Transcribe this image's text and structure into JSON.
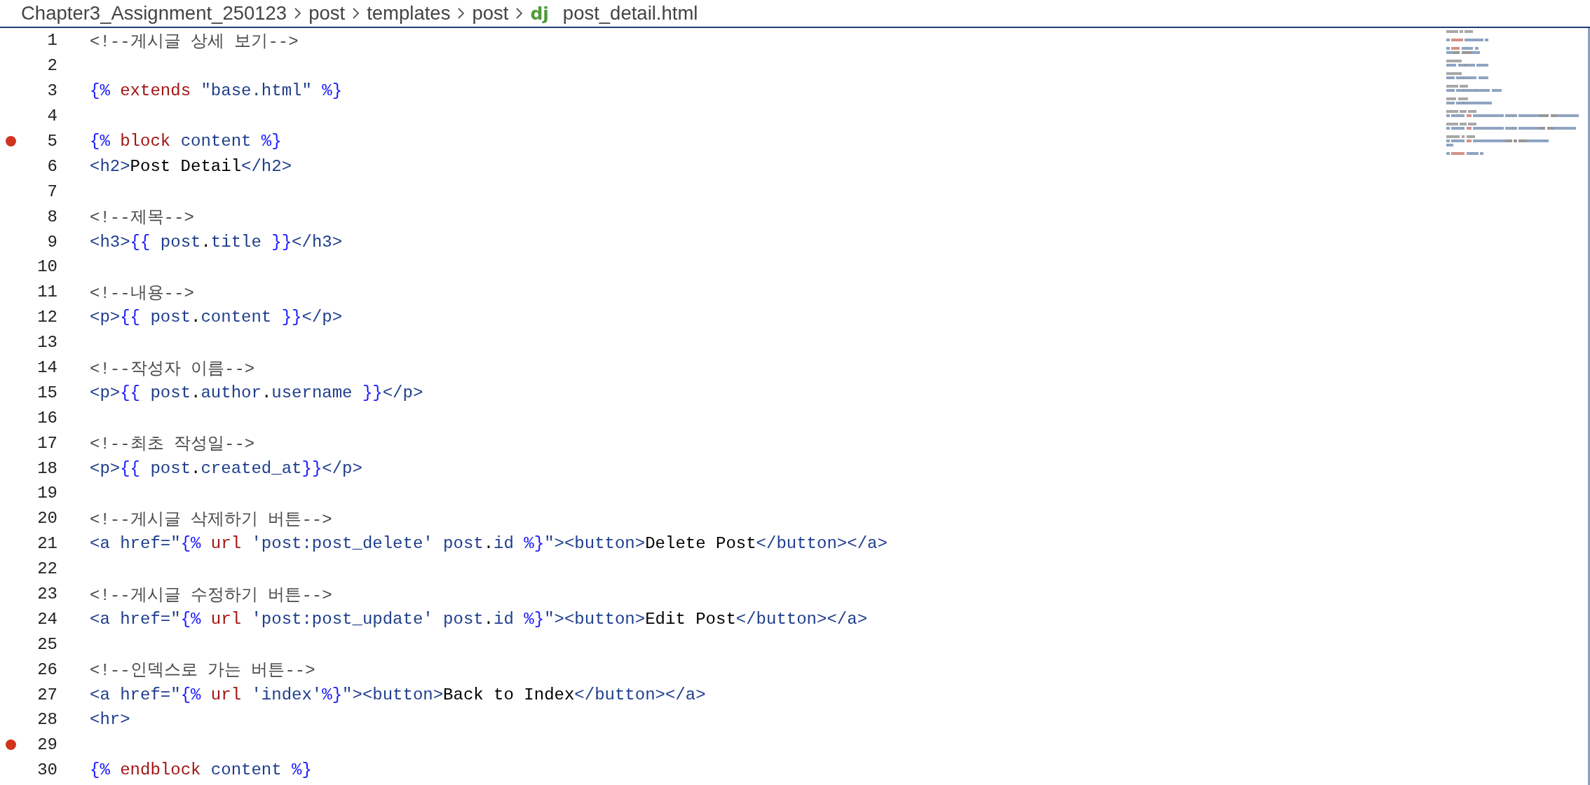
{
  "breadcrumb": {
    "segments": [
      "Chapter3_Assignment_250123",
      "post",
      "templates",
      "post"
    ],
    "file_icon": "dj",
    "file": "post_detail.html"
  },
  "lines": [
    {
      "n": "1",
      "breakpoint": false,
      "tokens": [
        {
          "kind": "comment",
          "text": "<!--게시글 상세 보기-->"
        }
      ]
    },
    {
      "n": "2",
      "breakpoint": false
    },
    {
      "n": "3",
      "breakpoint": false,
      "tokens": [
        {
          "kind": "delim",
          "text": "{% "
        },
        {
          "kind": "keyword",
          "text": "extends"
        },
        {
          "kind": "tag",
          "text": " \"base.html\" "
        },
        {
          "kind": "delim",
          "text": "%}"
        }
      ]
    },
    {
      "n": "4",
      "breakpoint": false
    },
    {
      "n": "5",
      "breakpoint": true,
      "tokens": [
        {
          "kind": "delim",
          "text": "{% "
        },
        {
          "kind": "keyword",
          "text": "block"
        },
        {
          "kind": "tag",
          "text": " content "
        },
        {
          "kind": "delim",
          "text": "%}"
        }
      ]
    },
    {
      "n": "6",
      "breakpoint": false,
      "tokens": [
        {
          "kind": "tag",
          "text": "<h2>"
        },
        {
          "kind": "text",
          "text": "Post Detail"
        },
        {
          "kind": "tag",
          "text": "</h2>"
        }
      ]
    },
    {
      "n": "7",
      "breakpoint": false
    },
    {
      "n": "8",
      "breakpoint": false,
      "tokens": [
        {
          "kind": "comment",
          "text": "<!--제목-->"
        }
      ]
    },
    {
      "n": "9",
      "breakpoint": false,
      "tokens": [
        {
          "kind": "tag",
          "text": "<h3>"
        },
        {
          "kind": "delim",
          "text": "{{"
        },
        {
          "kind": "tag",
          "text": " post"
        },
        {
          "kind": "text",
          "text": "."
        },
        {
          "kind": "tag",
          "text": "title "
        },
        {
          "kind": "delim",
          "text": "}}"
        },
        {
          "kind": "tag",
          "text": "</h3>"
        }
      ]
    },
    {
      "n": "10",
      "breakpoint": false
    },
    {
      "n": "11",
      "breakpoint": false,
      "tokens": [
        {
          "kind": "comment",
          "text": "<!--내용-->"
        }
      ]
    },
    {
      "n": "12",
      "breakpoint": false,
      "tokens": [
        {
          "kind": "tag",
          "text": "<p>"
        },
        {
          "kind": "delim",
          "text": "{{"
        },
        {
          "kind": "tag",
          "text": " post"
        },
        {
          "kind": "text",
          "text": "."
        },
        {
          "kind": "tag",
          "text": "content "
        },
        {
          "kind": "delim",
          "text": "}}"
        },
        {
          "kind": "tag",
          "text": "</p>"
        }
      ]
    },
    {
      "n": "13",
      "breakpoint": false
    },
    {
      "n": "14",
      "breakpoint": false,
      "tokens": [
        {
          "kind": "comment",
          "text": "<!--작성자 이름-->"
        }
      ]
    },
    {
      "n": "15",
      "breakpoint": false,
      "tokens": [
        {
          "kind": "tag",
          "text": "<p>"
        },
        {
          "kind": "delim",
          "text": "{{"
        },
        {
          "kind": "tag",
          "text": " post"
        },
        {
          "kind": "text",
          "text": "."
        },
        {
          "kind": "tag",
          "text": "author"
        },
        {
          "kind": "text",
          "text": "."
        },
        {
          "kind": "tag",
          "text": "username "
        },
        {
          "kind": "delim",
          "text": "}}"
        },
        {
          "kind": "tag",
          "text": "</p>"
        }
      ]
    },
    {
      "n": "16",
      "breakpoint": false
    },
    {
      "n": "17",
      "breakpoint": false,
      "tokens": [
        {
          "kind": "comment",
          "text": "<!--최초 작성일-->"
        }
      ]
    },
    {
      "n": "18",
      "breakpoint": false,
      "tokens": [
        {
          "kind": "tag",
          "text": "<p>"
        },
        {
          "kind": "delim",
          "text": "{{"
        },
        {
          "kind": "tag",
          "text": " post"
        },
        {
          "kind": "text",
          "text": "."
        },
        {
          "kind": "tag",
          "text": "created_at"
        },
        {
          "kind": "delim",
          "text": "}}"
        },
        {
          "kind": "tag",
          "text": "</p>"
        }
      ]
    },
    {
      "n": "19",
      "breakpoint": false
    },
    {
      "n": "20",
      "breakpoint": false,
      "tokens": [
        {
          "kind": "comment",
          "text": "<!--게시글 삭제하기 버튼-->"
        }
      ]
    },
    {
      "n": "21",
      "breakpoint": false,
      "tokens": [
        {
          "kind": "tag",
          "text": "<a href=\""
        },
        {
          "kind": "delim",
          "text": "{%"
        },
        {
          "kind": "keyword",
          "text": " url"
        },
        {
          "kind": "tag",
          "text": " 'post:post_delete' post"
        },
        {
          "kind": "text",
          "text": "."
        },
        {
          "kind": "tag",
          "text": "id "
        },
        {
          "kind": "delim",
          "text": "%}"
        },
        {
          "kind": "tag",
          "text": "\"><button>"
        },
        {
          "kind": "text",
          "text": "Delete Post"
        },
        {
          "kind": "tag",
          "text": "</button></a>"
        }
      ]
    },
    {
      "n": "22",
      "breakpoint": false
    },
    {
      "n": "23",
      "breakpoint": false,
      "tokens": [
        {
          "kind": "comment",
          "text": "<!--게시글 수정하기 버튼-->"
        }
      ]
    },
    {
      "n": "24",
      "breakpoint": false,
      "tokens": [
        {
          "kind": "tag",
          "text": "<a href=\""
        },
        {
          "kind": "delim",
          "text": "{%"
        },
        {
          "kind": "keyword",
          "text": " url"
        },
        {
          "kind": "tag",
          "text": " 'post:post_update' post"
        },
        {
          "kind": "text",
          "text": "."
        },
        {
          "kind": "tag",
          "text": "id "
        },
        {
          "kind": "delim",
          "text": "%}"
        },
        {
          "kind": "tag",
          "text": "\"><button>"
        },
        {
          "kind": "text",
          "text": "Edit Post"
        },
        {
          "kind": "tag",
          "text": "</button></a>"
        }
      ]
    },
    {
      "n": "25",
      "breakpoint": false
    },
    {
      "n": "26",
      "breakpoint": false,
      "tokens": [
        {
          "kind": "comment",
          "text": "<!--인덱스로 가는 버튼-->"
        }
      ]
    },
    {
      "n": "27",
      "breakpoint": false,
      "tokens": [
        {
          "kind": "tag",
          "text": "<a href=\""
        },
        {
          "kind": "delim",
          "text": "{%"
        },
        {
          "kind": "keyword",
          "text": " url"
        },
        {
          "kind": "tag",
          "text": " 'index'"
        },
        {
          "kind": "delim",
          "text": "%}"
        },
        {
          "kind": "tag",
          "text": "\"><button>"
        },
        {
          "kind": "text",
          "text": "Back to Index"
        },
        {
          "kind": "tag",
          "text": "</button></a>"
        }
      ]
    },
    {
      "n": "28",
      "breakpoint": false,
      "tokens": [
        {
          "kind": "tag",
          "text": "<hr>"
        }
      ]
    },
    {
      "n": "29",
      "breakpoint": true
    },
    {
      "n": "30",
      "breakpoint": false,
      "tokens": [
        {
          "kind": "delim",
          "text": "{% "
        },
        {
          "kind": "keyword",
          "text": "endblock"
        },
        {
          "kind": "tag",
          "text": " content "
        },
        {
          "kind": "delim",
          "text": "%}"
        }
      ]
    }
  ]
}
